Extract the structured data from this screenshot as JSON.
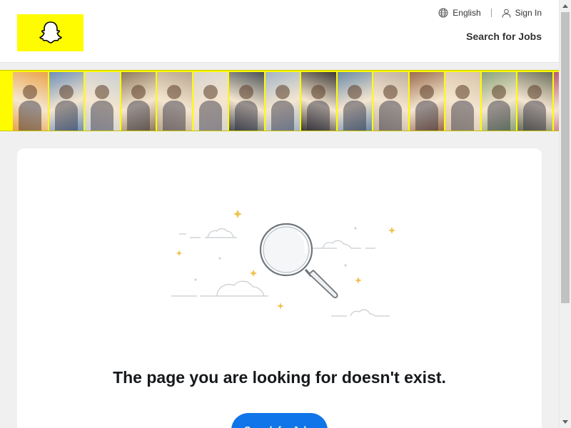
{
  "header": {
    "language_label": "English",
    "sign_in_label": "Sign In",
    "jobs_link": "Search for Jobs"
  },
  "banner": {
    "tiles": [
      "#e9a34a",
      "#6f8fb7",
      "#c9cfd4",
      "#8f7a5d",
      "#b7a58f",
      "#d8d4cf",
      "#4a5157",
      "#a3b5c7",
      "#3d3a36",
      "#6b8aa6",
      "#c0b0a0",
      "#9b6c4e",
      "#d7c3a8",
      "#8aa27a",
      "#6b6f5c",
      "#b65a73",
      "#e5bfa1",
      "#4b5c8a"
    ]
  },
  "main": {
    "message": "The page you are looking for doesn't exist.",
    "cta_label": "Search for Jobs"
  },
  "colors": {
    "brand": "#fffc00",
    "cta": "#0f75e8",
    "text": "#16191c"
  },
  "icons": {
    "logo": "snapchat-ghost-icon",
    "language": "globe-icon",
    "sign_in": "user-icon",
    "illustration": "magnifying-glass-icon"
  }
}
